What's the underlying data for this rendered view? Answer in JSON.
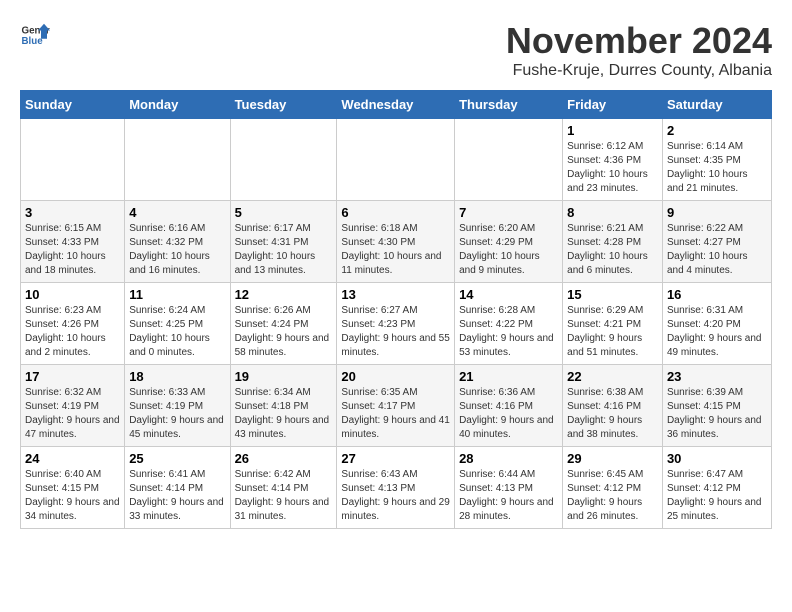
{
  "logo": {
    "text_general": "General",
    "text_blue": "Blue"
  },
  "title": "November 2024",
  "subtitle": "Fushe-Kruje, Durres County, Albania",
  "days_of_week": [
    "Sunday",
    "Monday",
    "Tuesday",
    "Wednesday",
    "Thursday",
    "Friday",
    "Saturday"
  ],
  "weeks": [
    [
      {
        "day": "",
        "info": ""
      },
      {
        "day": "",
        "info": ""
      },
      {
        "day": "",
        "info": ""
      },
      {
        "day": "",
        "info": ""
      },
      {
        "day": "",
        "info": ""
      },
      {
        "day": "1",
        "info": "Sunrise: 6:12 AM\nSunset: 4:36 PM\nDaylight: 10 hours and 23 minutes."
      },
      {
        "day": "2",
        "info": "Sunrise: 6:14 AM\nSunset: 4:35 PM\nDaylight: 10 hours and 21 minutes."
      }
    ],
    [
      {
        "day": "3",
        "info": "Sunrise: 6:15 AM\nSunset: 4:33 PM\nDaylight: 10 hours and 18 minutes."
      },
      {
        "day": "4",
        "info": "Sunrise: 6:16 AM\nSunset: 4:32 PM\nDaylight: 10 hours and 16 minutes."
      },
      {
        "day": "5",
        "info": "Sunrise: 6:17 AM\nSunset: 4:31 PM\nDaylight: 10 hours and 13 minutes."
      },
      {
        "day": "6",
        "info": "Sunrise: 6:18 AM\nSunset: 4:30 PM\nDaylight: 10 hours and 11 minutes."
      },
      {
        "day": "7",
        "info": "Sunrise: 6:20 AM\nSunset: 4:29 PM\nDaylight: 10 hours and 9 minutes."
      },
      {
        "day": "8",
        "info": "Sunrise: 6:21 AM\nSunset: 4:28 PM\nDaylight: 10 hours and 6 minutes."
      },
      {
        "day": "9",
        "info": "Sunrise: 6:22 AM\nSunset: 4:27 PM\nDaylight: 10 hours and 4 minutes."
      }
    ],
    [
      {
        "day": "10",
        "info": "Sunrise: 6:23 AM\nSunset: 4:26 PM\nDaylight: 10 hours and 2 minutes."
      },
      {
        "day": "11",
        "info": "Sunrise: 6:24 AM\nSunset: 4:25 PM\nDaylight: 10 hours and 0 minutes."
      },
      {
        "day": "12",
        "info": "Sunrise: 6:26 AM\nSunset: 4:24 PM\nDaylight: 9 hours and 58 minutes."
      },
      {
        "day": "13",
        "info": "Sunrise: 6:27 AM\nSunset: 4:23 PM\nDaylight: 9 hours and 55 minutes."
      },
      {
        "day": "14",
        "info": "Sunrise: 6:28 AM\nSunset: 4:22 PM\nDaylight: 9 hours and 53 minutes."
      },
      {
        "day": "15",
        "info": "Sunrise: 6:29 AM\nSunset: 4:21 PM\nDaylight: 9 hours and 51 minutes."
      },
      {
        "day": "16",
        "info": "Sunrise: 6:31 AM\nSunset: 4:20 PM\nDaylight: 9 hours and 49 minutes."
      }
    ],
    [
      {
        "day": "17",
        "info": "Sunrise: 6:32 AM\nSunset: 4:19 PM\nDaylight: 9 hours and 47 minutes."
      },
      {
        "day": "18",
        "info": "Sunrise: 6:33 AM\nSunset: 4:19 PM\nDaylight: 9 hours and 45 minutes."
      },
      {
        "day": "19",
        "info": "Sunrise: 6:34 AM\nSunset: 4:18 PM\nDaylight: 9 hours and 43 minutes."
      },
      {
        "day": "20",
        "info": "Sunrise: 6:35 AM\nSunset: 4:17 PM\nDaylight: 9 hours and 41 minutes."
      },
      {
        "day": "21",
        "info": "Sunrise: 6:36 AM\nSunset: 4:16 PM\nDaylight: 9 hours and 40 minutes."
      },
      {
        "day": "22",
        "info": "Sunrise: 6:38 AM\nSunset: 4:16 PM\nDaylight: 9 hours and 38 minutes."
      },
      {
        "day": "23",
        "info": "Sunrise: 6:39 AM\nSunset: 4:15 PM\nDaylight: 9 hours and 36 minutes."
      }
    ],
    [
      {
        "day": "24",
        "info": "Sunrise: 6:40 AM\nSunset: 4:15 PM\nDaylight: 9 hours and 34 minutes."
      },
      {
        "day": "25",
        "info": "Sunrise: 6:41 AM\nSunset: 4:14 PM\nDaylight: 9 hours and 33 minutes."
      },
      {
        "day": "26",
        "info": "Sunrise: 6:42 AM\nSunset: 4:14 PM\nDaylight: 9 hours and 31 minutes."
      },
      {
        "day": "27",
        "info": "Sunrise: 6:43 AM\nSunset: 4:13 PM\nDaylight: 9 hours and 29 minutes."
      },
      {
        "day": "28",
        "info": "Sunrise: 6:44 AM\nSunset: 4:13 PM\nDaylight: 9 hours and 28 minutes."
      },
      {
        "day": "29",
        "info": "Sunrise: 6:45 AM\nSunset: 4:12 PM\nDaylight: 9 hours and 26 minutes."
      },
      {
        "day": "30",
        "info": "Sunrise: 6:47 AM\nSunset: 4:12 PM\nDaylight: 9 hours and 25 minutes."
      }
    ]
  ]
}
